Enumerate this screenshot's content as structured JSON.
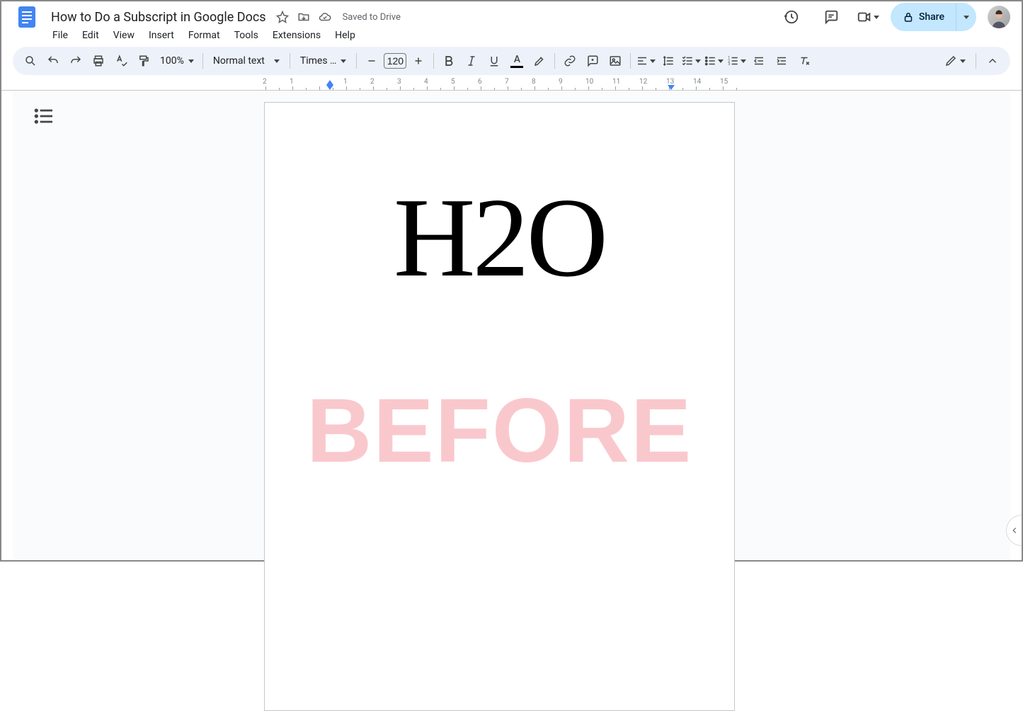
{
  "header": {
    "title": "How to Do a Subscript in Google Docs",
    "save_status": "Saved to Drive"
  },
  "menu": {
    "file": "File",
    "edit": "Edit",
    "view": "View",
    "insert": "Insert",
    "format": "Format",
    "tools": "Tools",
    "extensions": "Extensions",
    "help": "Help"
  },
  "toolbar": {
    "zoom": "100%",
    "style": "Normal text",
    "font": "Times …",
    "font_size": "120"
  },
  "share": {
    "label": "Share"
  },
  "ruler": {
    "labels": [
      "2",
      "1",
      "",
      "1",
      "2",
      "3",
      "4",
      "5",
      "6",
      "7",
      "8",
      "9",
      "10",
      "11",
      "12",
      "13",
      "14",
      "15"
    ]
  },
  "document": {
    "line1": "H2O",
    "watermark": "BEFORE"
  }
}
